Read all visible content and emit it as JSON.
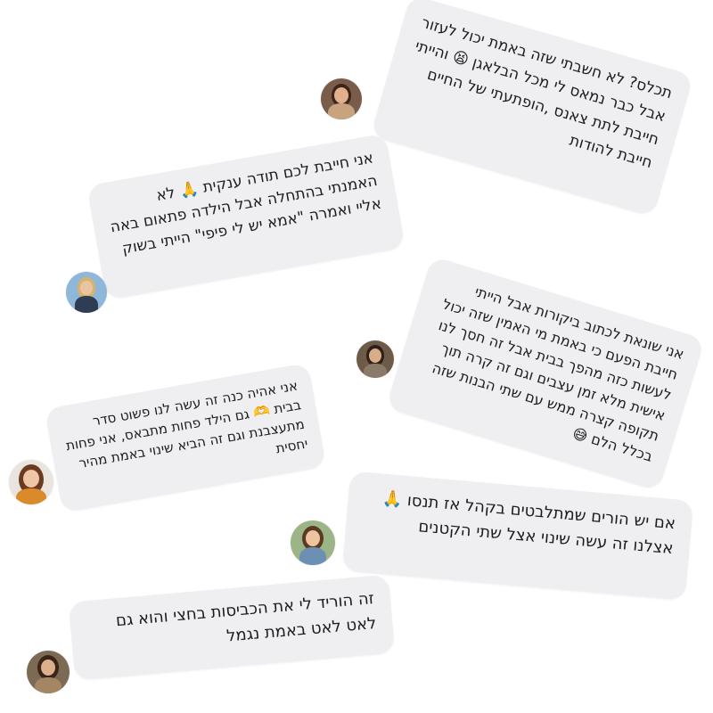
{
  "messages": [
    {
      "id": "m1",
      "text": "תכלס? לא חשבתי שזה באמת יכול לעזור אבל כבר נמאס לי מכל הבלאגן 😫 והייתי חייבת לתת צאנס ,הופתעתי של החיים חייבת להודות",
      "avatar_colors": {
        "bg": "#7a5c4a",
        "hair": "#3b2418",
        "face": "#e3b08e",
        "body": "#c9a27e"
      }
    },
    {
      "id": "m2",
      "text": "אני חייבת לכם תודה ענקית 🙏 לא האמנתי בהתחלה אבל הילדה פתאום באה אליי ואמרה \"אמא יש לי פיפי\" הייתי בשוק",
      "avatar_colors": {
        "bg": "#8fb7d9",
        "hair": "#d9b36a",
        "face": "#e9c4a3",
        "body": "#2f3d52"
      }
    },
    {
      "id": "m3",
      "text": "אני שונאת לכתוב ביקורות אבל הייתי חייבת הפעם כי באמת מי האמין שזה יכול לעשות כזה מהפך בבית אבל זה חסך לנו אישית מלא זמן עצבים וגם זה קרה תוך תקופה קצרה ממש עם שתי הבנות שזה בכלל הלם 😅",
      "avatar_colors": {
        "bg": "#6e5a48",
        "hair": "#2e2016",
        "face": "#d8ad8a",
        "body": "#8a7a6a"
      }
    },
    {
      "id": "m4",
      "text": "אני אהיה כנה זה עשה לנו פשוט סדר בבית 🫶 גם הילד פחות מתבאס, אני פחות מתעצבנת וגם זה הביא שינוי באמת מהיר יחסית",
      "avatar_colors": {
        "bg": "#e9e4de",
        "hair": "#6b3a1f",
        "face": "#f0c7a6",
        "body": "#d98a2b"
      }
    },
    {
      "id": "m5",
      "text": "אם יש הורים שמתלבטים בקהל אז תנסו 🙏אצלנו זה עשה שינוי אצל שתי הקטנים",
      "avatar_colors": {
        "bg": "#9bb587",
        "hair": "#5a3a22",
        "face": "#eec3a0",
        "body": "#6c8fb4"
      }
    },
    {
      "id": "m6",
      "text": "זה הוריד לי את הכביסות בחצי והוא גם לאט לאט באמת נגמל",
      "avatar_colors": {
        "bg": "#7d6a55",
        "hair": "#3a2518",
        "face": "#dcb08c",
        "body": "#a48665"
      }
    }
  ]
}
